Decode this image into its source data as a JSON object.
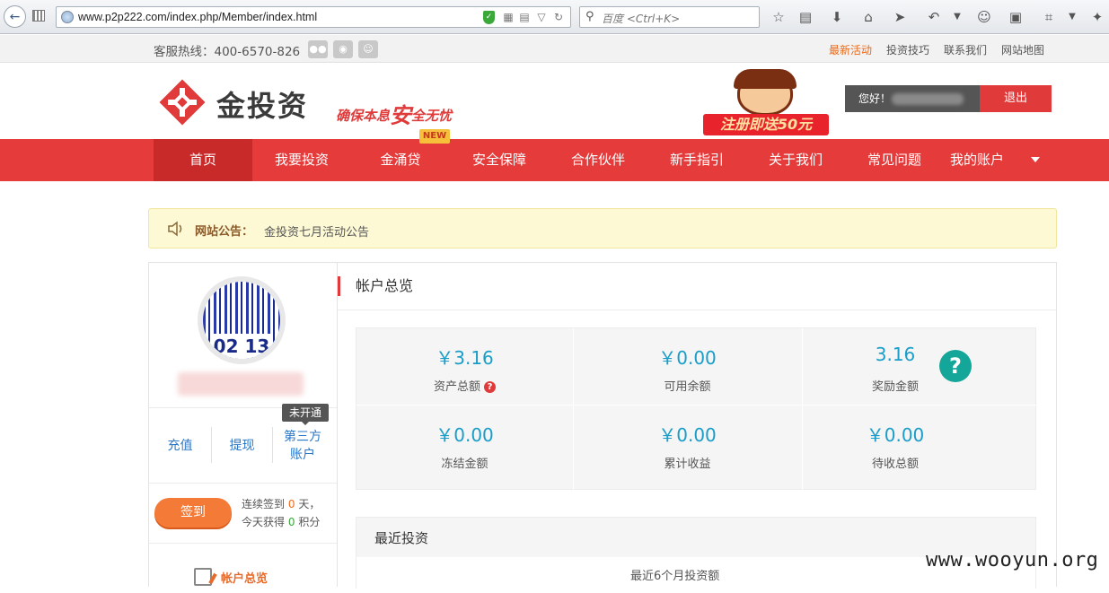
{
  "browser": {
    "url": "www.p2p222.com/index.php/Member/index.html",
    "search_placeholder": "百度 <Ctrl+K>"
  },
  "topbar": {
    "hotline": "客服热线：400-6570-826",
    "links": [
      "最新活动",
      "投资技巧",
      "联系我们",
      "网站地图"
    ]
  },
  "header": {
    "logo_text": "金投资",
    "slogan_a": "确保本息",
    "slogan_b": "安",
    "slogan_c": "全无忧",
    "promo_text": "注册即送50元",
    "greeting": "您好！",
    "logout": "退出"
  },
  "nav": {
    "items": [
      "首页",
      "我要投资",
      "金涌贷",
      "安全保障",
      "合作伙伴",
      "新手指引",
      "关于我们",
      "常见问题",
      "我的账户"
    ],
    "new_badge": "NEW"
  },
  "notice": {
    "label": "网站公告：",
    "message": "金投资七月活动公告"
  },
  "sidebar": {
    "actions": [
      "充值",
      "提现",
      "第三方账户"
    ],
    "tooltip": "未开通",
    "sign_button": "签到",
    "sign_line1_a": "连续签到",
    "sign_days": "0",
    "sign_line1_b": "天，",
    "sign_line2_a": "今天获得",
    "sign_points": "0",
    "sign_line2_b": "积分",
    "menu_first": "帐户总览"
  },
  "account": {
    "title": "帐户总览",
    "stats": [
      {
        "value": "￥3.16",
        "label": "资产总额"
      },
      {
        "value": "￥0.00",
        "label": "可用余额"
      },
      {
        "value": "3.16",
        "label": "奖励金额"
      },
      {
        "value": "￥0.00",
        "label": "冻结金额"
      },
      {
        "value": "￥0.00",
        "label": "累计收益"
      },
      {
        "value": "￥0.00",
        "label": "待收总额"
      }
    ],
    "help_mark": "?",
    "asset_help_mark": "?"
  },
  "recent": {
    "title": "最近投资",
    "subtitle": "最近6个月投资额"
  },
  "watermark": "www.wooyun.org",
  "colors": {
    "brand_red": "#e63b3b",
    "value_blue": "#1a9dc8",
    "sign_orange": "#f47a38",
    "help_teal": "#15a69a"
  }
}
